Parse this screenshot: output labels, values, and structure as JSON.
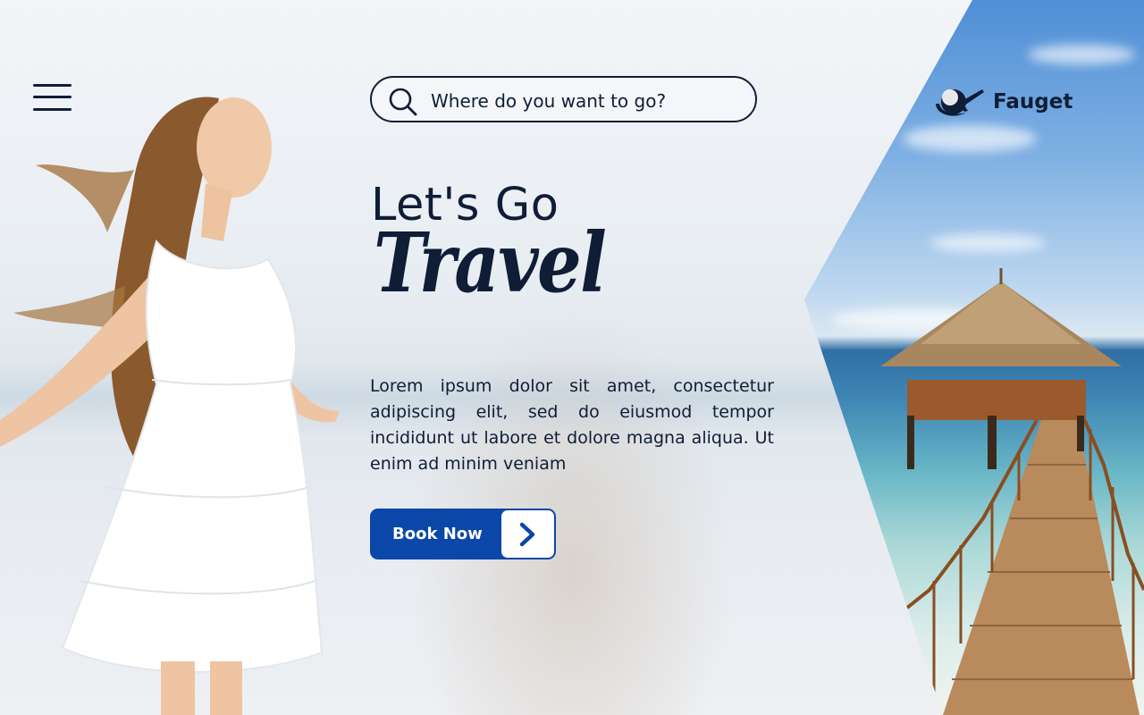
{
  "header": {
    "search_placeholder": "Where do you want to go?",
    "brand": "Fauget"
  },
  "hero": {
    "title_line1": "Let's Go",
    "title_line2": "Travel",
    "description": "Lorem ipsum dolor sit amet, consectetur adipiscing elit, sed do eiusmod tempor incididunt ut labore et dolore magna aliqua. Ut enim ad minim veniam",
    "cta_label": "Book Now"
  },
  "colors": {
    "primary_dark": "#0f1d36",
    "accent_blue": "#0a47a8"
  },
  "icons": {
    "menu": "hamburger-menu-icon",
    "search": "search-icon",
    "logo": "plane-globe-logo-icon",
    "cta_arrow": "chevron-right-icon"
  }
}
